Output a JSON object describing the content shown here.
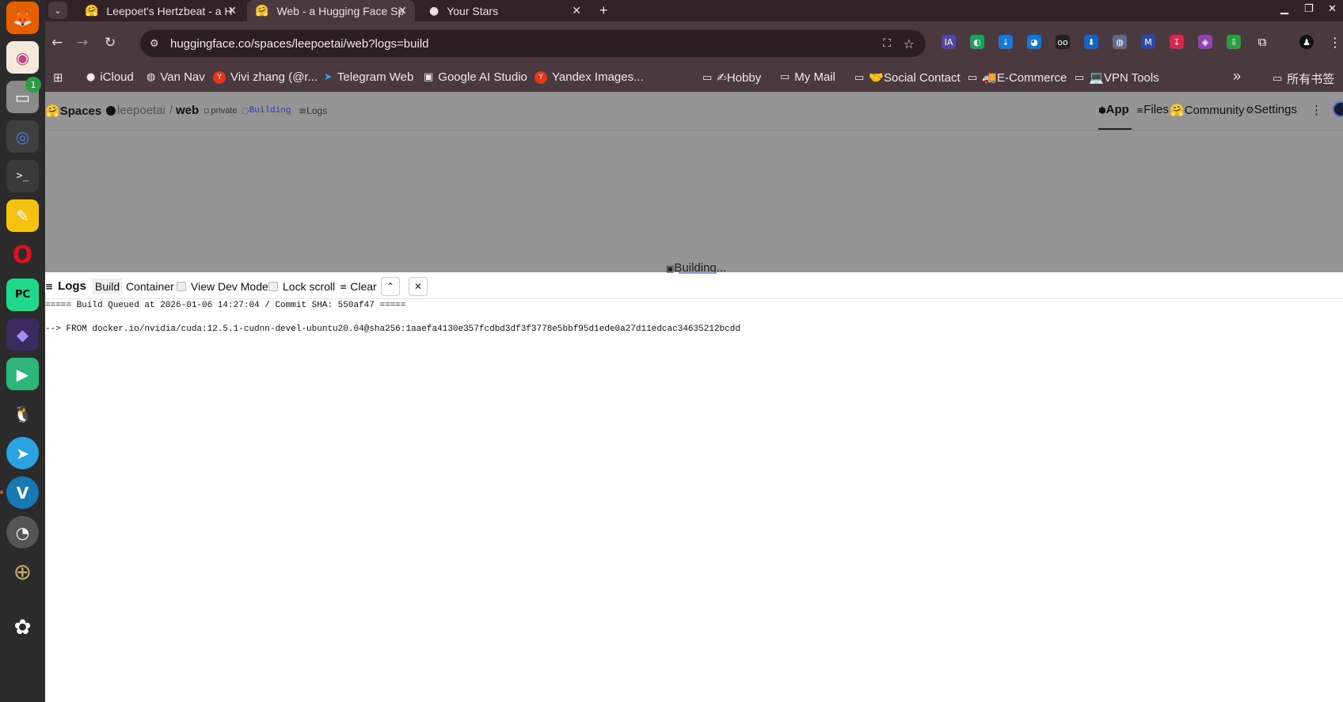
{
  "dock": {
    "items": [
      {
        "name": "firefox-icon",
        "glyph": "🦊",
        "color": "#e66000"
      },
      {
        "name": "photos-icon",
        "glyph": "◉",
        "color": "#f0e4d8"
      },
      {
        "name": "files-icon",
        "glyph": "▭",
        "color": "#8a8a8a",
        "badge": "1"
      },
      {
        "name": "chrome-icon",
        "glyph": "◎",
        "color": "#4285f4"
      },
      {
        "name": "terminal-icon",
        "glyph": ">_",
        "color": "#333333"
      },
      {
        "name": "text-editor-icon",
        "glyph": "✎",
        "color": "#f5c211"
      },
      {
        "name": "opera-icon",
        "glyph": "O",
        "color": "#e0101e"
      },
      {
        "name": "pycharm-icon",
        "glyph": "PC",
        "color": "#21d789"
      },
      {
        "name": "obsidian-icon",
        "glyph": "◆",
        "color": "#5a3f9e"
      },
      {
        "name": "send-app-icon",
        "glyph": "▶",
        "color": "#2fb47c"
      },
      {
        "name": "qq-icon",
        "glyph": "🐧",
        "color": "#2b2b2b"
      },
      {
        "name": "telegram-icon",
        "glyph": "➤",
        "color": "#2aa3e0"
      },
      {
        "name": "vivaldi-icon",
        "glyph": "V",
        "color": "#1877b5"
      },
      {
        "name": "speedometer-icon",
        "glyph": "◔",
        "color": "#555555"
      },
      {
        "name": "crosshair-icon",
        "glyph": "⊕",
        "color": "#2b2b2b"
      },
      {
        "name": "ubuntu-icon",
        "glyph": "✿",
        "color": "#2b2b2b"
      }
    ]
  },
  "browser": {
    "tabs": [
      {
        "title": "Leepoet's Hertzbeat - a H",
        "icon": "🤗",
        "active": false
      },
      {
        "title": "Web - a Hugging Face Sp",
        "icon": "🤗",
        "active": true
      },
      {
        "title": "Your Stars",
        "icon": "●",
        "active": false
      }
    ],
    "new_tab": "+",
    "url": "huggingface.co/spaces/leepoetai/web?logs=build",
    "bookmarks": [
      {
        "label": "iCloud",
        "icon": ""
      },
      {
        "label": "Van Nav",
        "icon": "◍"
      },
      {
        "label": "Vivi zhang (@r...",
        "icon": "Y"
      },
      {
        "label": "Telegram Web",
        "icon": "➤"
      },
      {
        "label": "Google AI Studio",
        "icon": "▣"
      },
      {
        "label": "Yandex Images...",
        "icon": "Y"
      },
      {
        "label": "✍Hobby",
        "icon": "▭"
      },
      {
        "label": "My Mail",
        "icon": "▭"
      },
      {
        "label": "🤝Social Contact",
        "icon": "▭"
      },
      {
        "label": "🚚E-Commerce",
        "icon": "▭"
      },
      {
        "label": "💻VPN Tools",
        "icon": "▭"
      }
    ],
    "all_bookmarks": "所有书签",
    "overflow": "»"
  },
  "hf": {
    "spaces": "Spaces",
    "owner": "leepoetai",
    "slash": "/",
    "repo": "web",
    "private_badge": "private",
    "status_badge": "Building",
    "logs_link": "Logs",
    "tabs": {
      "app": "App",
      "files": "Files",
      "community": "Community",
      "settings": "Settings"
    },
    "building_text": "Building..."
  },
  "logs": {
    "title": "Logs",
    "build_tab": "Build",
    "container_tab": "Container",
    "dev_mode": "View Dev Mode",
    "lock_scroll": "Lock scroll",
    "clear": "Clear",
    "lines": [
      "===== Build Queued at 2026-01-06 14:27:04 / Commit SHA: 550af47 =====",
      "--> FROM docker.io/nvidia/cuda:12.5.1-cudnn-devel-ubuntu20.04@sha256:1aaefa4130e357fcdbd3df3f3778e5bbf95d1ede0a27d11edcac34635212bcdd"
    ]
  }
}
